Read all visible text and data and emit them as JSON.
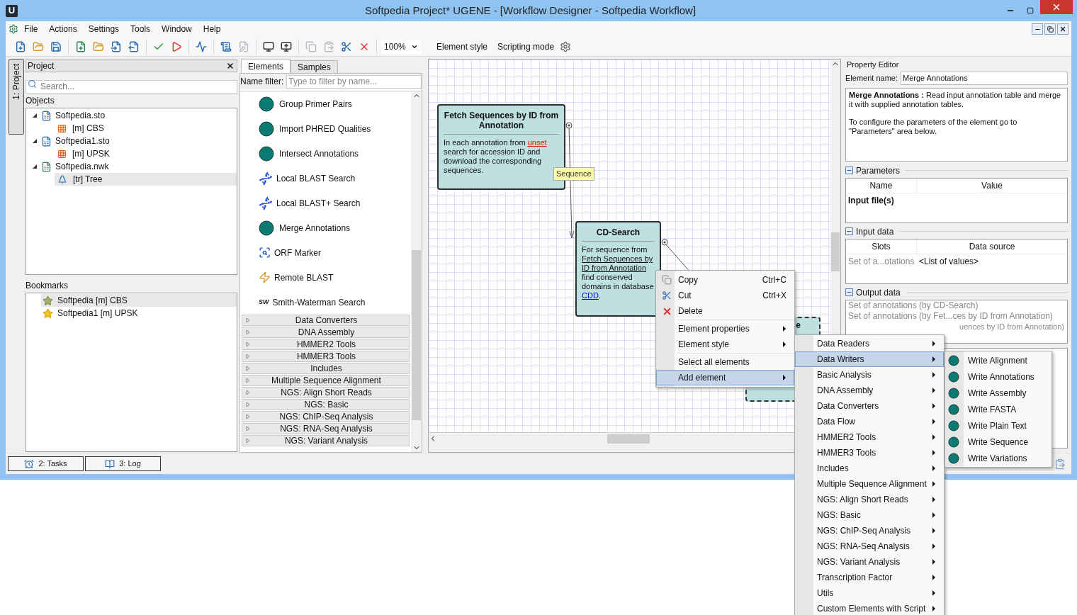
{
  "window": {
    "title": "Softpedia Project* UGENE - [Workflow Designer - Softpedia Workflow]",
    "app_letter": "U"
  },
  "menu_bar": [
    "File",
    "Actions",
    "Settings",
    "Tools",
    "Window",
    "Help"
  ],
  "toolbar": {
    "groups": [
      [
        {
          "kind": "new",
          "disabled": false
        },
        {
          "kind": "open",
          "disabled": false
        },
        {
          "kind": "save",
          "disabled": false
        }
      ],
      [
        {
          "kind": "new-element",
          "disabled": false
        },
        {
          "kind": "load",
          "disabled": false
        },
        {
          "kind": "import",
          "disabled": false
        },
        {
          "kind": "export",
          "disabled": false
        }
      ],
      [
        {
          "kind": "validate",
          "disabled": false
        },
        {
          "kind": "run",
          "disabled": false
        }
      ],
      [
        {
          "kind": "estimate",
          "disabled": false
        }
      ],
      [
        {
          "kind": "script",
          "disabled": false
        },
        {
          "kind": "script-edit",
          "disabled": true
        }
      ],
      [
        {
          "kind": "screen",
          "disabled": false
        },
        {
          "kind": "screen-up",
          "disabled": false
        }
      ],
      [
        {
          "kind": "copy",
          "disabled": true
        },
        {
          "kind": "paste",
          "disabled": true
        },
        {
          "kind": "cut",
          "disabled": false
        },
        {
          "kind": "delete",
          "disabled": false
        }
      ]
    ],
    "zoom": "100%",
    "element_style": "Element style",
    "scripting_mode": "Scripting mode"
  },
  "side_tabs": [
    {
      "label": "1: Project",
      "selected": true
    }
  ],
  "project": {
    "title": "Project",
    "search_placeholder": "Search...",
    "objects_label": "Objects",
    "objects": [
      {
        "label": "Softpedia.sto",
        "kind": "document",
        "expanded": true,
        "selected": false,
        "children": [
          {
            "label": "[m] CBS",
            "kind": "alignment",
            "selected": false
          }
        ]
      },
      {
        "label": "Softpedia1.sto",
        "kind": "document",
        "expanded": true,
        "selected": false,
        "children": [
          {
            "label": "[m] UPSK",
            "kind": "alignment",
            "selected": false
          }
        ]
      },
      {
        "label": "Softpedia.nwk",
        "kind": "tree-document",
        "expanded": true,
        "selected": false,
        "children": [
          {
            "label": "[tr] Tree",
            "kind": "tree",
            "selected": true
          }
        ]
      }
    ],
    "bookmarks_label": "Bookmarks",
    "bookmarks": [
      {
        "label": "Softpedia [m] CBS",
        "selected": true
      },
      {
        "label": "Softpedia1 [m] UPSK",
        "selected": false
      }
    ]
  },
  "elements_panel": {
    "tabs": [
      {
        "label": "Elements",
        "selected": true
      },
      {
        "label": "Samples",
        "selected": false
      }
    ],
    "filter_label": "Name filter:",
    "filter_placeholder": "Type to filter by name...",
    "items": [
      {
        "label": "Group Primer Pairs",
        "kind": "circle"
      },
      {
        "label": "Import PHRED Qualities",
        "kind": "circle"
      },
      {
        "label": "Intersect Annotations",
        "kind": "circle"
      },
      {
        "label": "Local BLAST Search",
        "kind": "blast"
      },
      {
        "label": "Local BLAST+ Search",
        "kind": "blast"
      },
      {
        "label": "Merge Annotations",
        "kind": "circle"
      },
      {
        "label": "ORF Marker",
        "kind": "orf"
      },
      {
        "label": "Remote BLAST",
        "kind": "remote"
      },
      {
        "label": "Smith-Waterman Search",
        "kind": "sw",
        "icon_text": "SW"
      }
    ],
    "groups": [
      {
        "label": "Data Converters",
        "expanded": false
      },
      {
        "label": "DNA Assembly",
        "expanded": false
      },
      {
        "label": "HMMER2 Tools",
        "expanded": false
      },
      {
        "label": "HMMER3 Tools",
        "expanded": false
      },
      {
        "label": "Includes",
        "expanded": false
      },
      {
        "label": "Multiple Sequence Alignment",
        "expanded": false
      },
      {
        "label": "NGS: Align Short Reads",
        "expanded": false
      },
      {
        "label": "NGS: Basic",
        "expanded": false
      },
      {
        "label": "NGS: ChIP-Seq Analysis",
        "expanded": false
      },
      {
        "label": "NGS: RNA-Seq Analysis",
        "expanded": false
      },
      {
        "label": "NGS: Variant Analysis",
        "expanded": false
      }
    ]
  },
  "canvas": {
    "nodes": [
      {
        "title": "Fetch Sequences by ID from Annotation",
        "selected": false,
        "description": [
          {
            "kind": "text",
            "text": "In each annotation from "
          },
          {
            "kind": "unset",
            "text": "unset"
          },
          {
            "kind": "text",
            "text": " search for accession ID and download the corresponding sequences."
          }
        ]
      },
      {
        "title": "CD-Search",
        "selected": false,
        "description": [
          {
            "kind": "text",
            "text": "For sequence from "
          },
          {
            "kind": "ref",
            "text": "Fetch Sequences by"
          },
          {
            "kind": "ref",
            "text": "ID from Annotation"
          },
          {
            "kind": "text",
            "text": " find conserved domains in database "
          },
          {
            "kind": "link",
            "text": "CDD"
          },
          {
            "kind": "text",
            "text": "."
          }
        ]
      },
      {
        "title": "e",
        "selected": true
      }
    ],
    "port_label": "Sequence"
  },
  "property_editor": {
    "title": "Property Editor",
    "element_name_label": "Element name:",
    "element_name": "Merge Annotations",
    "description": "**Merge Annotations :** Read input annotation table and merge it with supplied annotation tables.",
    "hint": "To configure the parameters of the element go to \"Parameters\" area below.",
    "parameters": {
      "title": "Parameters",
      "expanded": true,
      "columns": [
        "Name",
        "Value"
      ],
      "rows": [
        {
          "name": "Input file(s)"
        }
      ]
    },
    "input_data": {
      "title": "Input data",
      "expanded": true,
      "columns": [
        "Slots",
        "Data source"
      ],
      "rows": [
        {
          "slot": "Set of a...otations",
          "source": "<List of values>"
        }
      ]
    },
    "output_data": {
      "title": "Output data",
      "expanded": true,
      "rows": [
        "Set of annotations (by CD-Search)",
        "Set of annotations (by Fet...ces by ID from Annotation)",
        "uences by ID from Annotation)"
      ]
    }
  },
  "status_bar": {
    "buttons": [
      {
        "label": "2: Tasks",
        "kind": "tasks"
      },
      {
        "label": "3: Log",
        "kind": "log"
      }
    ]
  },
  "context_menu": {
    "items": [
      {
        "kind": "copy",
        "label": "Copy",
        "shortcut": "Ctrl+C",
        "selected": false
      },
      {
        "kind": "cut",
        "label": "Cut",
        "shortcut": "Ctrl+X",
        "selected": false
      },
      {
        "kind": "delete",
        "label": "Delete",
        "selected": false
      },
      {
        "kind": "separator"
      },
      {
        "kind": "submenu",
        "label": "Element properties",
        "selected": false
      },
      {
        "kind": "submenu",
        "label": "Element style",
        "selected": false
      },
      {
        "kind": "separator"
      },
      {
        "kind": "plain",
        "label": "Select all elements",
        "selected": false
      },
      {
        "kind": "submenu",
        "label": "Add element",
        "selected": true
      }
    ]
  },
  "add_element_menu": {
    "items": [
      {
        "label": "Data Readers",
        "selected": false
      },
      {
        "label": "Data Writers",
        "selected": true
      },
      {
        "label": "Basic Analysis",
        "selected": false
      },
      {
        "label": "DNA Assembly",
        "selected": false
      },
      {
        "label": "Data Converters",
        "selected": false
      },
      {
        "label": "Data Flow",
        "selected": false
      },
      {
        "label": "HMMER2 Tools",
        "selected": false
      },
      {
        "label": "HMMER3 Tools",
        "selected": false
      },
      {
        "label": "Includes",
        "selected": false
      },
      {
        "label": "Multiple Sequence Alignment",
        "selected": false
      },
      {
        "label": "NGS: Align Short Reads",
        "selected": false
      },
      {
        "label": "NGS: Basic",
        "selected": false
      },
      {
        "label": "NGS: ChIP-Seq Analysis",
        "selected": false
      },
      {
        "label": "NGS: RNA-Seq Analysis",
        "selected": false
      },
      {
        "label": "NGS: Variant Analysis",
        "selected": false
      },
      {
        "label": "Transcription Factor",
        "selected": false
      },
      {
        "label": "Utils",
        "selected": false
      },
      {
        "label": "Custom Elements with Script",
        "selected": false
      }
    ]
  },
  "data_writers_menu": {
    "items": [
      "Write Alignment",
      "Write Annotations",
      "Write Assembly",
      "Write FASTA",
      "Write Plain Text",
      "Write Sequence",
      "Write Variations"
    ]
  }
}
